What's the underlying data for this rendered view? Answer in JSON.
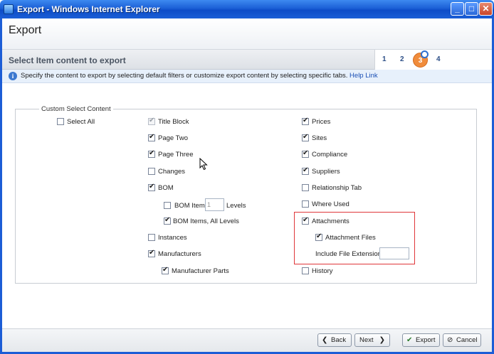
{
  "window": {
    "title": "Export - Windows Internet Explorer",
    "controls": {
      "minimize": "_",
      "maximize": "□",
      "close": "✕"
    }
  },
  "page": {
    "title": "Export"
  },
  "step_header": {
    "title": "Select Item content to export",
    "steps": [
      "1",
      "2",
      "3",
      "4"
    ],
    "active_step": "3"
  },
  "info": {
    "text": "Specify the content to export by selecting default filters or customize export content by selecting specific tabs.",
    "link": "Help Link"
  },
  "group": {
    "legend": "Custom Select Content"
  },
  "options": {
    "select_all": {
      "label": "Select All",
      "checked": false
    },
    "title_block": {
      "label": "Title Block",
      "checked": true,
      "disabled": true
    },
    "page_two": {
      "label": "Page Two",
      "checked": true
    },
    "page_three": {
      "label": "Page Three",
      "checked": true
    },
    "changes": {
      "label": "Changes",
      "checked": false
    },
    "bom": {
      "label": "BOM",
      "checked": true
    },
    "bom_items": {
      "label": "BOM Items",
      "checked": false
    },
    "bom_levels_value": "1",
    "bom_levels_label": "Levels",
    "bom_items_all_levels": {
      "label": "BOM Items, All Levels",
      "checked": true
    },
    "instances": {
      "label": "Instances",
      "checked": false
    },
    "manufacturers": {
      "label": "Manufacturers",
      "checked": true
    },
    "manufacturer_parts": {
      "label": "Manufacturer Parts",
      "checked": true
    },
    "prices": {
      "label": "Prices",
      "checked": true
    },
    "sites": {
      "label": "Sites",
      "checked": true
    },
    "compliance": {
      "label": "Compliance",
      "checked": true
    },
    "suppliers": {
      "label": "Suppliers",
      "checked": true
    },
    "relationship_tab": {
      "label": "Relationship Tab",
      "checked": false
    },
    "where_used": {
      "label": "Where Used",
      "checked": false
    },
    "attachments": {
      "label": "Attachments",
      "checked": true
    },
    "attachment_files": {
      "label": "Attachment Files",
      "checked": true
    },
    "include_file_extensions": {
      "label": "Include File Extensions:",
      "value": ""
    },
    "history": {
      "label": "History",
      "checked": false
    }
  },
  "footer": {
    "back": "Back",
    "next": "Next",
    "export": "Export",
    "cancel": "Cancel"
  },
  "colors": {
    "title_bar": "#1b5fd6",
    "active_step": "#f08c3c",
    "highlight_border": "#e0363a",
    "link": "#1a4fb5"
  }
}
